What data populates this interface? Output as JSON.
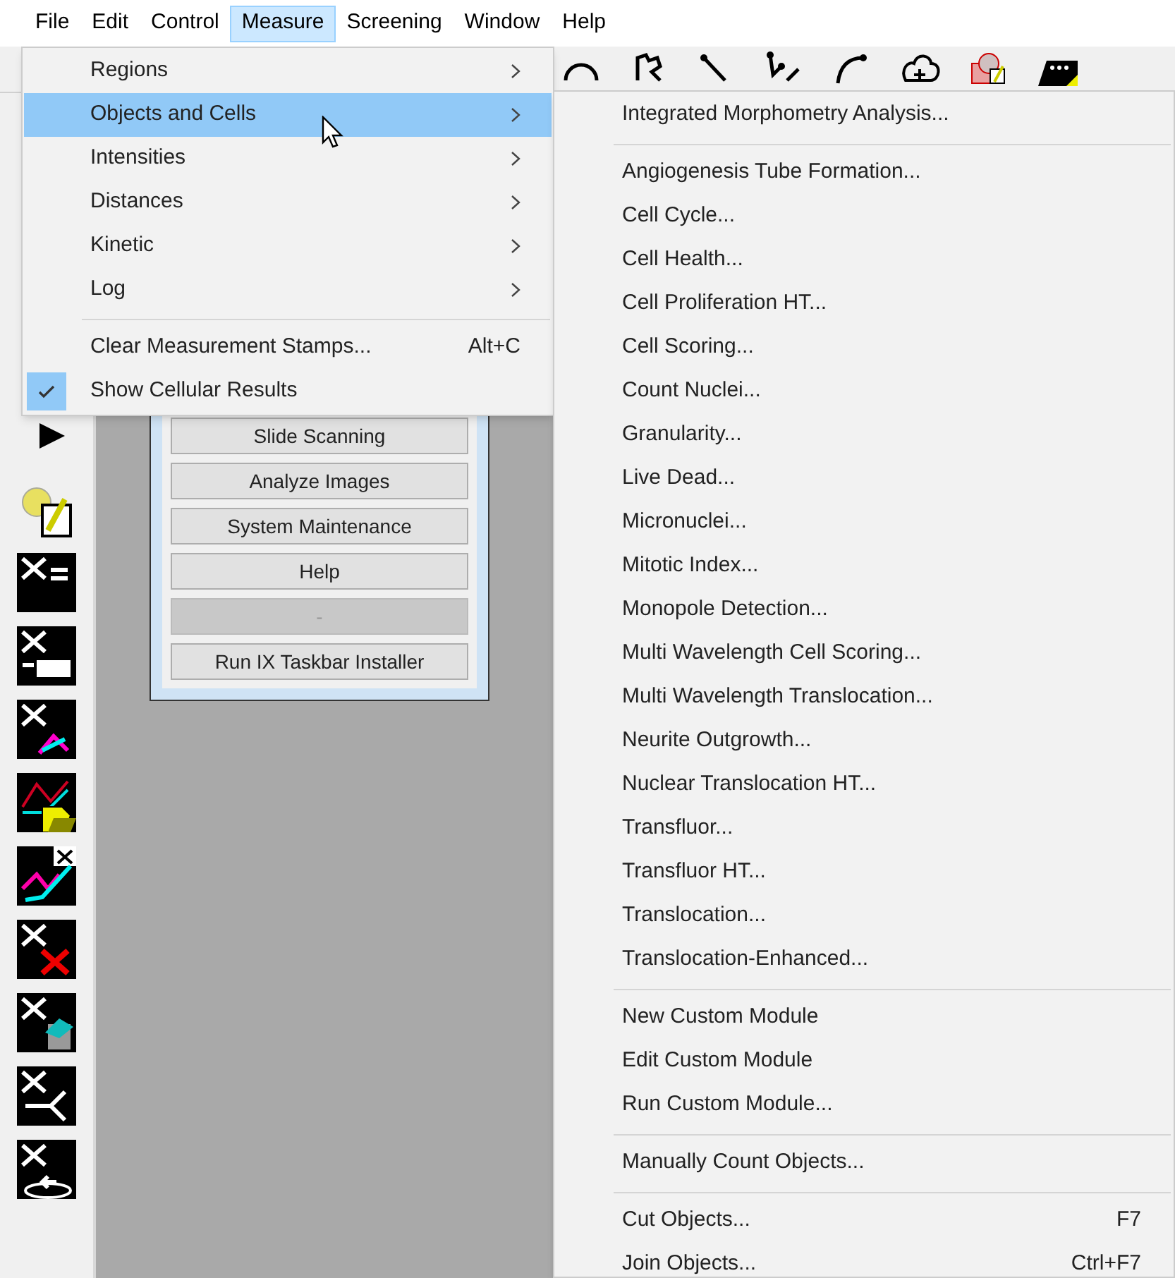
{
  "menubar": [
    {
      "label": "File",
      "selected": false
    },
    {
      "label": "Edit",
      "selected": false
    },
    {
      "label": "Control",
      "selected": false
    },
    {
      "label": "Measure",
      "selected": true
    },
    {
      "label": "Screening",
      "selected": false
    },
    {
      "label": "Window",
      "selected": false
    },
    {
      "label": "Help",
      "selected": false
    }
  ],
  "measure_menu": [
    {
      "kind": "submenu",
      "label": "Regions",
      "selected": false
    },
    {
      "kind": "submenu",
      "label": "Objects and Cells",
      "selected": true
    },
    {
      "kind": "submenu",
      "label": "Intensities",
      "selected": false
    },
    {
      "kind": "submenu",
      "label": "Distances",
      "selected": false
    },
    {
      "kind": "submenu",
      "label": "Kinetic",
      "selected": false
    },
    {
      "kind": "submenu",
      "label": "Log",
      "selected": false
    },
    {
      "kind": "separator"
    },
    {
      "kind": "command",
      "label": "Clear Measurement Stamps...",
      "shortcut": "Alt+C",
      "checked": false,
      "selected": false
    },
    {
      "kind": "command",
      "label": "Show Cellular Results",
      "checked": true,
      "selected": false
    }
  ],
  "objects_submenu": [
    {
      "kind": "command",
      "label": "Integrated Morphometry Analysis..."
    },
    {
      "kind": "separator"
    },
    {
      "kind": "command",
      "label": "Angiogenesis Tube Formation..."
    },
    {
      "kind": "command",
      "label": "Cell Cycle..."
    },
    {
      "kind": "command",
      "label": "Cell Health..."
    },
    {
      "kind": "command",
      "label": "Cell Proliferation HT..."
    },
    {
      "kind": "command",
      "label": "Cell Scoring..."
    },
    {
      "kind": "command",
      "label": "Count Nuclei..."
    },
    {
      "kind": "command",
      "label": "Granularity..."
    },
    {
      "kind": "command",
      "label": "Live Dead..."
    },
    {
      "kind": "command",
      "label": "Micronuclei..."
    },
    {
      "kind": "command",
      "label": "Mitotic Index..."
    },
    {
      "kind": "command",
      "label": "Monopole Detection..."
    },
    {
      "kind": "command",
      "label": "Multi Wavelength Cell Scoring..."
    },
    {
      "kind": "command",
      "label": "Multi Wavelength Translocation..."
    },
    {
      "kind": "command",
      "label": "Neurite Outgrowth..."
    },
    {
      "kind": "command",
      "label": "Nuclear Translocation HT..."
    },
    {
      "kind": "command",
      "label": "Transfluor..."
    },
    {
      "kind": "command",
      "label": "Transfluor HT..."
    },
    {
      "kind": "command",
      "label": "Translocation..."
    },
    {
      "kind": "command",
      "label": "Translocation-Enhanced..."
    },
    {
      "kind": "separator"
    },
    {
      "kind": "command",
      "label": "New Custom Module"
    },
    {
      "kind": "command",
      "label": "Edit Custom Module"
    },
    {
      "kind": "command",
      "label": "Run Custom Module..."
    },
    {
      "kind": "separator"
    },
    {
      "kind": "command",
      "label": "Manually Count Objects..."
    },
    {
      "kind": "separator"
    },
    {
      "kind": "command",
      "label": "Cut Objects...",
      "shortcut": "F7"
    },
    {
      "kind": "command",
      "label": "Join Objects...",
      "shortcut": "Ctrl+F7"
    }
  ],
  "dialog": {
    "buttons": [
      {
        "label": "Slide Scanning",
        "disabled": false
      },
      {
        "label": "Analyze Images",
        "disabled": false
      },
      {
        "label": "System Maintenance",
        "disabled": false
      },
      {
        "label": "Help",
        "disabled": false
      },
      {
        "label": "-",
        "disabled": true
      },
      {
        "label": "Run IX Taskbar Installer",
        "disabled": false
      }
    ]
  }
}
